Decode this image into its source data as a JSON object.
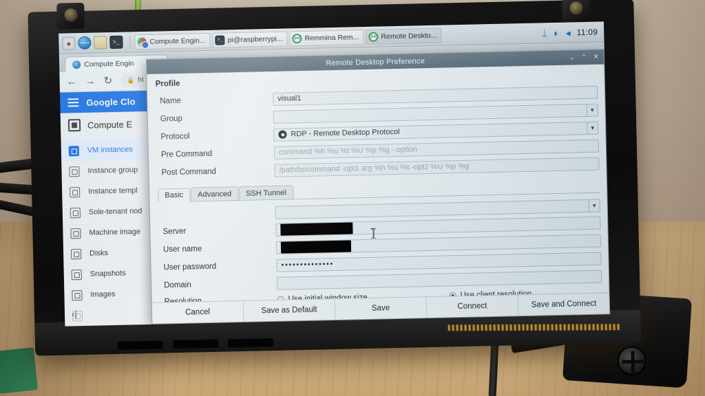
{
  "taskbar": {
    "launcher_icons": [
      {
        "name": "raspberry-pi-menu-icon",
        "glyph": "●"
      },
      {
        "name": "web-browser-icon",
        "glyph": ""
      },
      {
        "name": "file-manager-icon",
        "glyph": ""
      },
      {
        "name": "terminal-icon",
        "glyph": ">_"
      }
    ],
    "tasks": [
      {
        "label": "Compute Engin...",
        "icon": "chrome-icon",
        "active": false
      },
      {
        "label": "pi@raspberrypi...",
        "icon": "terminal-icon",
        "active": false
      },
      {
        "label": "Remmina Rem...",
        "icon": "remmina-icon",
        "active": false
      },
      {
        "label": "Remote Deskto...",
        "icon": "remmina-icon",
        "active": true
      }
    ],
    "tray": [
      {
        "name": "bluetooth-icon",
        "glyph": "ᛦ"
      },
      {
        "name": "wifi-icon",
        "glyph": "◠"
      },
      {
        "name": "volume-icon",
        "glyph": "◂"
      }
    ],
    "clock": "11:09"
  },
  "browser": {
    "tab_title": "Compute Engin",
    "nav": {
      "back": "←",
      "forward": "→",
      "reload": "↻"
    },
    "address": "ht",
    "lock": "🔒"
  },
  "gcp": {
    "brand": "Google Clo",
    "product": "Compute E",
    "items": [
      {
        "label": "VM instances",
        "active": true
      },
      {
        "label": "Instance group",
        "active": false
      },
      {
        "label": "Instance templ",
        "active": false
      },
      {
        "label": "Sole-tenant nod",
        "active": false
      },
      {
        "label": "Machine image",
        "active": false
      },
      {
        "label": "Disks",
        "active": false
      },
      {
        "label": "Snapshots",
        "active": false
      },
      {
        "label": "Images",
        "active": false
      }
    ],
    "collapse": "‹|"
  },
  "dialog": {
    "title": "Remote Desktop Preference",
    "window_buttons": {
      "minimize": "⌄",
      "maximize": "⌃",
      "close": "✕"
    },
    "section": "Profile",
    "fields": {
      "name": {
        "label": "Name",
        "value": "visual1",
        "placeholder": ""
      },
      "group": {
        "label": "Group",
        "value": "",
        "placeholder": ""
      },
      "protocol": {
        "label": "Protocol",
        "value": "RDP - Remote Desktop Protocol"
      },
      "pre_command": {
        "label": "Pre Command",
        "value": "",
        "placeholder": "command %h %u %t %U %p %g --option"
      },
      "post_command": {
        "label": "Post Command",
        "value": "",
        "placeholder": "/path/to/command -opt1 arg %h %u %t -opt2 %U %p %g"
      }
    },
    "tabs": [
      {
        "label": "Basic",
        "active": true
      },
      {
        "label": "Advanced",
        "active": false
      },
      {
        "label": "SSH Tunnel",
        "active": false
      }
    ],
    "basic": {
      "server": {
        "label": "Server",
        "value": "",
        "redacted": true
      },
      "user_name": {
        "label": "User name",
        "value": "",
        "redacted": true
      },
      "user_password": {
        "label": "User password",
        "value": "••••••••••••••"
      },
      "domain": {
        "label": "Domain",
        "value": ""
      },
      "resolution": {
        "label": "Resolution",
        "option_initial": "Use initial window size",
        "option_client": "Use client resolution",
        "selected": "client"
      }
    },
    "buttons": [
      {
        "label": "Cancel",
        "name": "cancel-button"
      },
      {
        "label": "Save as Default",
        "name": "save-as-default-button"
      },
      {
        "label": "Save",
        "name": "save-button"
      },
      {
        "label": "Connect",
        "name": "connect-button"
      },
      {
        "label": "Save and Connect",
        "name": "save-and-connect-button"
      }
    ]
  },
  "colors": {
    "accent": "#1a73e8",
    "titlebar": "#5d6f7c",
    "dialog_bg": "#eef2f4",
    "redaction": "#000000"
  }
}
